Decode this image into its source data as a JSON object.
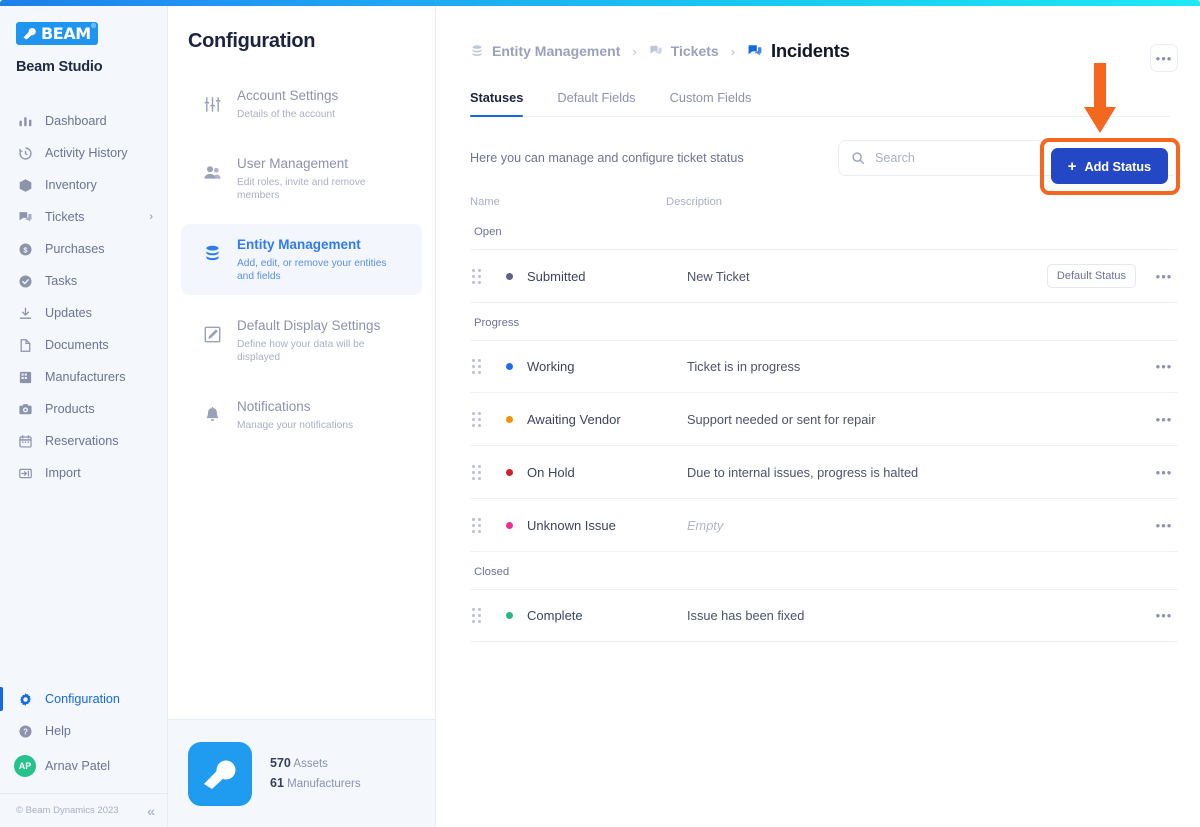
{
  "brand": {
    "logo_text": "BEAM",
    "logo_tm": "®",
    "studio_title": "Beam Studio"
  },
  "sidebar": {
    "items": [
      {
        "label": "Dashboard",
        "icon": "chart-bar-icon",
        "active": false,
        "chevron": false
      },
      {
        "label": "Activity History",
        "icon": "history-clock-icon",
        "active": false,
        "chevron": false
      },
      {
        "label": "Inventory",
        "icon": "cube-icon",
        "active": false,
        "chevron": false
      },
      {
        "label": "Tickets",
        "icon": "tickets-icon",
        "active": false,
        "chevron": true
      },
      {
        "label": "Purchases",
        "icon": "dollar-circle-icon",
        "active": false,
        "chevron": false
      },
      {
        "label": "Tasks",
        "icon": "check-circle-icon",
        "active": false,
        "chevron": false
      },
      {
        "label": "Updates",
        "icon": "download-icon",
        "active": false,
        "chevron": false
      },
      {
        "label": "Documents",
        "icon": "document-icon",
        "active": false,
        "chevron": false
      },
      {
        "label": "Manufacturers",
        "icon": "building-icon",
        "active": false,
        "chevron": false
      },
      {
        "label": "Products",
        "icon": "camera-icon",
        "active": false,
        "chevron": false
      },
      {
        "label": "Reservations",
        "icon": "calendar-icon",
        "active": false,
        "chevron": false
      },
      {
        "label": "Import",
        "icon": "import-icon",
        "active": false,
        "chevron": false
      }
    ],
    "bottom_items": [
      {
        "label": "Configuration",
        "icon": "gear-icon",
        "active": true
      },
      {
        "label": "Help",
        "icon": "question-circle-icon",
        "active": false
      }
    ],
    "user": {
      "initials": "AP",
      "name": "Arnav Patel"
    },
    "footer": {
      "copyright": "© Beam Dynamics 2023",
      "collapse_icon": "double-chevron-left-icon"
    }
  },
  "config": {
    "title": "Configuration",
    "items": [
      {
        "name": "Account Settings",
        "desc": "Details of the account",
        "icon": "sliders-icon",
        "selected": false
      },
      {
        "name": "User Management",
        "desc": "Edit roles, invite and remove members",
        "icon": "users-icon",
        "selected": false
      },
      {
        "name": "Entity Management",
        "desc": "Add, edit, or remove your entities and fields",
        "icon": "database-icon",
        "selected": true
      },
      {
        "name": "Default Display Settings",
        "desc": "Define how your data will be displayed",
        "icon": "edit-square-icon",
        "selected": false
      },
      {
        "name": "Notifications",
        "desc": "Manage your notifications",
        "icon": "bell-icon",
        "selected": false
      }
    ],
    "footer": {
      "assets_count": "570",
      "assets_label": "Assets",
      "manufacturers_count": "61",
      "manufacturers_label": "Manufacturers"
    }
  },
  "main": {
    "breadcrumb": [
      {
        "label": "Entity Management",
        "icon": "database-icon",
        "current": false
      },
      {
        "label": "Tickets",
        "icon": "tickets-icon",
        "current": false
      },
      {
        "label": "Incidents",
        "icon": "tickets-icon",
        "current": true
      }
    ],
    "breadcrumb_separator": "›",
    "more_menu_label": "•••",
    "tabs": [
      {
        "label": "Statuses",
        "active": true
      },
      {
        "label": "Default Fields",
        "active": false
      },
      {
        "label": "Custom Fields",
        "active": false
      }
    ],
    "subtitle": "Here you can manage and configure ticket status",
    "search": {
      "placeholder": "Search",
      "value": "",
      "icon": "search-icon"
    },
    "add_button": {
      "label": "Add Status",
      "icon": "plus-icon",
      "color": "#2447c6"
    },
    "annotation": {
      "color": "#f4671f",
      "arrow_icon": "down-arrow-annotation",
      "highlight": "add-status-button"
    },
    "table": {
      "headers": {
        "name": "Name",
        "description": "Description"
      },
      "groups": [
        {
          "group": "Open",
          "rows": [
            {
              "name": "Submitted",
              "description": "New Ticket",
              "dot_color": "#5b6486",
              "badge": "Default Status",
              "menu": "•••",
              "empty": false
            }
          ]
        },
        {
          "group": "Progress",
          "rows": [
            {
              "name": "Working",
              "description": "Ticket is in progress",
              "dot_color": "#1d6fe8",
              "badge": "",
              "menu": "•••",
              "empty": false
            },
            {
              "name": "Awaiting Vendor",
              "description": "Support needed or sent for repair",
              "dot_color": "#f2910c",
              "badge": "",
              "menu": "•••",
              "empty": false
            },
            {
              "name": "On Hold",
              "description": "Due to internal issues, progress is halted",
              "dot_color": "#d31f2e",
              "badge": "",
              "menu": "•••",
              "empty": false
            },
            {
              "name": "Unknown Issue",
              "description": "Empty",
              "dot_color": "#ec2d97",
              "badge": "",
              "menu": "•••",
              "empty": true
            }
          ]
        },
        {
          "group": "Closed",
          "rows": [
            {
              "name": "Complete",
              "description": "Issue has been fixed",
              "dot_color": "#23b981",
              "badge": "",
              "menu": "•••",
              "empty": false
            }
          ]
        }
      ]
    }
  }
}
